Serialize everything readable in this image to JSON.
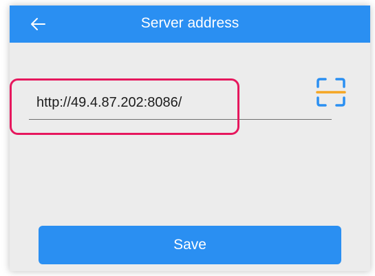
{
  "header": {
    "title": "Server address",
    "back_icon": "back-arrow-icon"
  },
  "server": {
    "url_value": "http://49.4.87.202:8086/",
    "scan_icon": "qr-scan-icon"
  },
  "actions": {
    "save_label": "Save"
  },
  "colors": {
    "primary": "#2a8ff2",
    "highlight": "#e6175d",
    "scan_frame": "#2a8ff2",
    "scan_line": "#f5a623",
    "background": "#ececec"
  }
}
